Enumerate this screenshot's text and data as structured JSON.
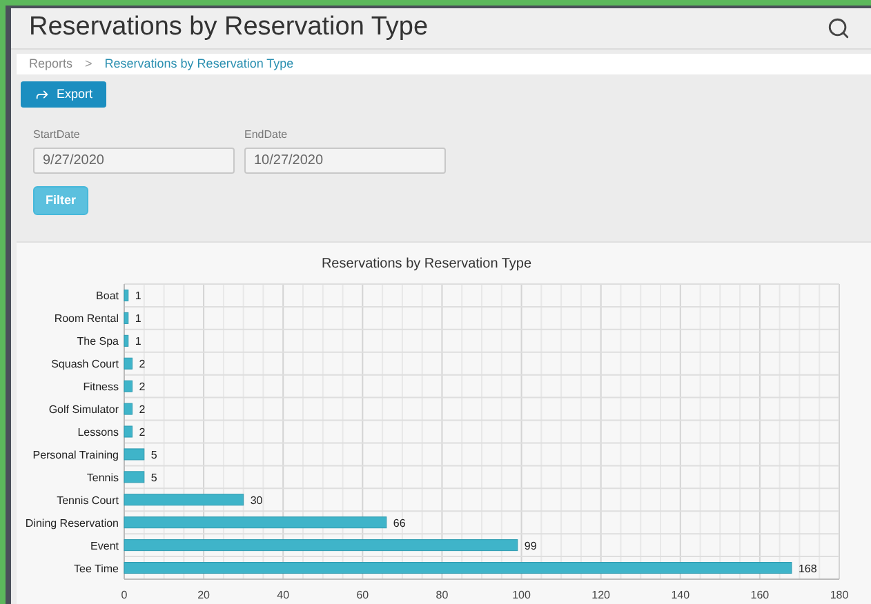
{
  "header": {
    "title": "Reservations by Reservation Type"
  },
  "breadcrumb": [
    {
      "label": "Reports",
      "selected": false
    },
    {
      "label": "Reservations by Reservation Type",
      "selected": true
    }
  ],
  "breadcrumb_separator": ">",
  "export_button": {
    "label": "Export"
  },
  "fields": [
    {
      "label": "StartDate",
      "value": "9/27/2020"
    },
    {
      "label": "EndDate",
      "value": "10/27/2020"
    }
  ],
  "filter_button": {
    "label": "Filter"
  },
  "chart": {
    "chart_data": {
      "type": "bar",
      "orientation": "horizontal",
      "title": "Reservations by Reservation Type",
      "categories": [
        "Boat",
        "Room Rental",
        "The Spa",
        "Squash Court",
        "Fitness",
        "Golf Simulator",
        "Lessons",
        "Personal Training",
        "Tennis",
        "Tennis Court",
        "Dining Reservation",
        "Event",
        "Tee Time"
      ],
      "series": [
        {
          "color": "#3fb4c9",
          "values": [
            1,
            1,
            1,
            2,
            2,
            2,
            2,
            5,
            5,
            30,
            66,
            99,
            168
          ]
        }
      ],
      "xlim": [
        0,
        180
      ],
      "xticks": [
        0,
        20,
        40,
        60,
        80,
        100,
        120,
        140,
        160,
        180
      ],
      "data_labels": true,
      "grid": true
    }
  }
}
